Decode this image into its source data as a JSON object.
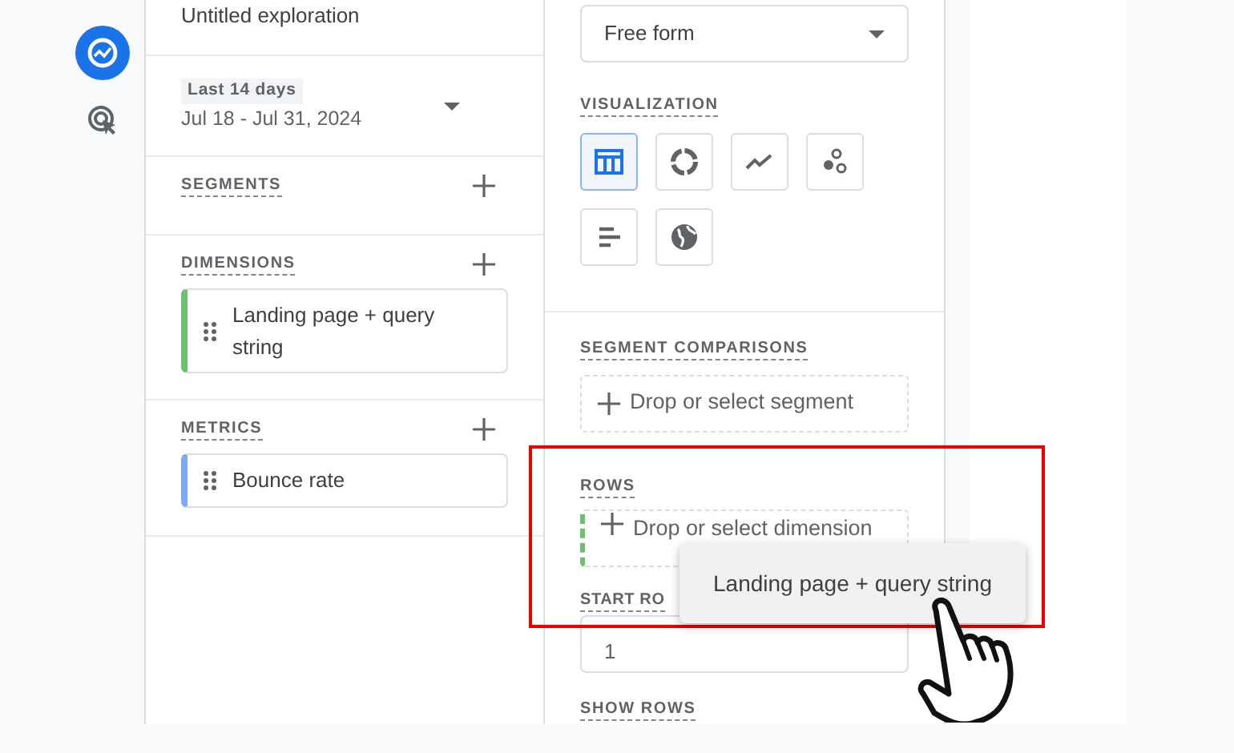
{
  "rail": {
    "items": [
      {
        "kind": "explore",
        "selected": true
      },
      {
        "kind": "cursor",
        "selected": false
      }
    ]
  },
  "variables": {
    "title": "Untitled exploration",
    "date_range": {
      "preset": "Last 14 days",
      "range": "Jul 18 - Jul 31, 2024"
    },
    "sections": [
      {
        "label": "SEGMENTS"
      },
      {
        "label": "DIMENSIONS",
        "items": [
          {
            "label": "Landing page + query string",
            "color": "#6cc070"
          }
        ]
      },
      {
        "label": "METRICS",
        "items": [
          {
            "label": "Bounce rate",
            "color": "#7baaf7"
          }
        ]
      }
    ]
  },
  "settings": {
    "technique": "Free form",
    "visualization": {
      "label": "VISUALIZATION",
      "options": [
        {
          "kind": "table",
          "selected": true
        },
        {
          "kind": "donut",
          "selected": false
        },
        {
          "kind": "line",
          "selected": false
        },
        {
          "kind": "scatter",
          "selected": false
        },
        {
          "kind": "bar",
          "selected": false
        },
        {
          "kind": "geo",
          "selected": false
        }
      ]
    },
    "segment_comparisons": {
      "label": "SEGMENT COMPARISONS",
      "placeholder": "Drop or select segment"
    },
    "rows": {
      "label": "ROWS",
      "placeholder": "Drop or select dimension",
      "drop_target": true
    },
    "start_row": {
      "label": "START RO",
      "value": "1"
    },
    "show_rows": {
      "label": "SHOW ROWS"
    }
  },
  "drag_chip": {
    "label": "Landing page + query string"
  }
}
